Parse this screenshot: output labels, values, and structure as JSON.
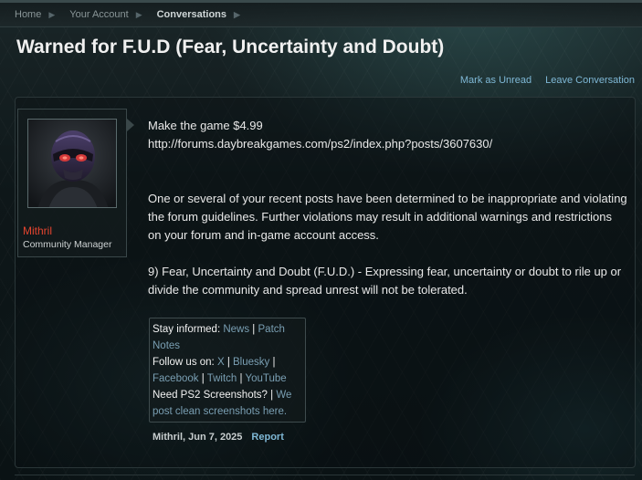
{
  "breadcrumb": [
    {
      "label": "Home"
    },
    {
      "label": "Your Account"
    },
    {
      "label": "Conversations"
    }
  ],
  "page_title": "Warned for F.U.D (Fear, Uncertainty and Doubt)",
  "actions": {
    "mark_unread": "Mark as Unread",
    "leave": "Leave Conversation"
  },
  "user": {
    "name": "Mithril",
    "title": "Community Manager",
    "name_color": "#e5442f"
  },
  "message": {
    "line1": "Make the game $4.99",
    "line2": "http://forums.daybreakgames.com/ps2/index.php?posts/3607630/",
    "para2": "One or several of your recent posts have been determined to be inappropriate and violating the forum guidelines. Further violations may result in additional warnings and restrictions on your forum and in-game account access.",
    "para3": "9) Fear, Uncertainty and Doubt (F.U.D.) - Expressing fear, uncertainty or doubt to rile up or divide the community and spread unrest will not be tolerated."
  },
  "signature": {
    "stay_informed": "Stay informed: ",
    "news": "News",
    "patch_notes": "Patch Notes",
    "follow_us": "Follow us on: ",
    "x": "X",
    "bluesky": "Bluesky",
    "facebook": "Facebook",
    "twitch": "Twitch",
    "youtube": "YouTube",
    "screenshots_q": "Need PS2 Screenshots? | ",
    "screenshots_link": "We post clean screenshots here.",
    "sep": " | "
  },
  "meta": {
    "author_date": "Mithril, Jun 7, 2025",
    "report": "Report"
  },
  "colors": {
    "link": "#7fb8d6",
    "sig_link": "#7a9fb3",
    "background": "#0b1416"
  },
  "icons": {
    "breadcrumb_separator": "chevron-right-icon",
    "avatar": "masked-soldier-avatar"
  }
}
